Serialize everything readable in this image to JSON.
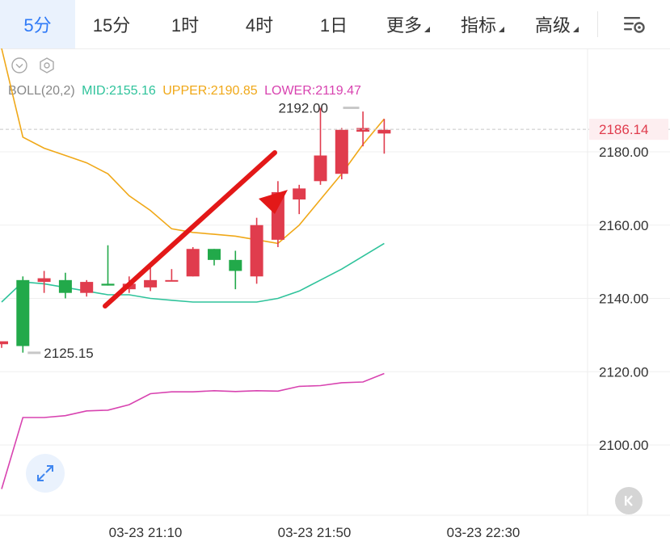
{
  "tabs": [
    {
      "label": "5分",
      "active": true,
      "dropdown": false
    },
    {
      "label": "15分",
      "active": false,
      "dropdown": false
    },
    {
      "label": "1时",
      "active": false,
      "dropdown": false
    },
    {
      "label": "4时",
      "active": false,
      "dropdown": false
    },
    {
      "label": "1日",
      "active": false,
      "dropdown": false
    },
    {
      "label": "更多",
      "active": false,
      "dropdown": true
    },
    {
      "label": "指标",
      "active": false,
      "dropdown": true
    },
    {
      "label": "高级",
      "active": false,
      "dropdown": true
    }
  ],
  "icons": {
    "settings": "chart-settings-icon",
    "collapse": "chevron-down-circle-icon",
    "indicator_settings": "hexagon-settings-icon",
    "expand": "expand-arrows-icon",
    "scroll_latest": "skip-to-latest-icon"
  },
  "legend": {
    "name": "BOLL(20,2)",
    "mid": "MID:2155.16",
    "upper": "UPPER:2190.85",
    "lower": "LOWER:2119.47"
  },
  "colors": {
    "accent": "#2f7af7",
    "up": "#e03c4d",
    "down": "#22a94a",
    "mid": "#2fc39b",
    "upper": "#f0a818",
    "lower": "#d843b0",
    "arrow": "#e31818",
    "grid": "#efefef",
    "current_price_bg": "#fdeef0"
  },
  "chart_data": {
    "type": "candlestick",
    "indicator": "BOLL(20,2)",
    "current_price": 2186.14,
    "high_label": "2192.00",
    "low_label": "2125.15",
    "ylim": [
      2088,
      2207
    ],
    "yticks": [
      "2180.00",
      "2160.00",
      "2140.00",
      "2120.00",
      "2100.00"
    ],
    "xticks": [
      "03-23 21:10",
      "03-23 21:50",
      "03-23 22:30"
    ],
    "candles": [
      {
        "open": 2127.5,
        "high": 2127.8,
        "low": 2126.5,
        "close": 2128.3
      },
      {
        "open": 2145.0,
        "high": 2146.0,
        "low": 2125.2,
        "close": 2127.0
      },
      {
        "open": 2144.5,
        "high": 2147.5,
        "low": 2141.5,
        "close": 2145.5
      },
      {
        "open": 2145.0,
        "high": 2147.0,
        "low": 2140.0,
        "close": 2141.5
      },
      {
        "open": 2141.5,
        "high": 2145.0,
        "low": 2140.5,
        "close": 2144.5
      },
      {
        "open": 2144.0,
        "high": 2154.5,
        "low": 2143.5,
        "close": 2143.5
      },
      {
        "open": 2142.5,
        "high": 2146.0,
        "low": 2141.5,
        "close": 2144.0
      },
      {
        "open": 2143.0,
        "high": 2149.5,
        "low": 2142.0,
        "close": 2145.0
      },
      {
        "open": 2145.0,
        "high": 2148.0,
        "low": 2145.0,
        "close": 2145.0
      },
      {
        "open": 2146.0,
        "high": 2154.0,
        "low": 2146.0,
        "close": 2153.5
      },
      {
        "open": 2153.5,
        "high": 2153.5,
        "low": 2149.0,
        "close": 2150.5
      },
      {
        "open": 2150.5,
        "high": 2153.0,
        "low": 2142.5,
        "close": 2147.5
      },
      {
        "open": 2146.0,
        "high": 2162.0,
        "low": 2144.0,
        "close": 2160.0
      },
      {
        "open": 2156.0,
        "high": 2172.0,
        "low": 2154.0,
        "close": 2169.0
      },
      {
        "open": 2167.0,
        "high": 2171.0,
        "low": 2163.0,
        "close": 2170.0
      },
      {
        "open": 2172.0,
        "high": 2192.0,
        "low": 2171.0,
        "close": 2179.0
      },
      {
        "open": 2174.0,
        "high": 2186.5,
        "low": 2172.5,
        "close": 2186.0
      },
      {
        "open": 2185.5,
        "high": 2191.0,
        "low": 2181.5,
        "close": 2186.5
      },
      {
        "open": 2185.0,
        "high": 2189.0,
        "low": 2179.5,
        "close": 2186.0
      }
    ],
    "upper_band": [
      2210,
      2184,
      2181,
      2179,
      2177,
      2174,
      2168,
      2164,
      2159,
      2158,
      2157.5,
      2157,
      2156,
      2155,
      2160,
      2167,
      2174,
      2182,
      2189
    ],
    "mid_band": [
      2139,
      2144.5,
      2144,
      2143,
      2142,
      2141,
      2141,
      2140,
      2139.5,
      2139,
      2139,
      2139,
      2139,
      2140,
      2142,
      2145,
      2148,
      2151.5,
      2155
    ],
    "lower_band": [
      2088,
      2107.5,
      2107.5,
      2108,
      2109.3,
      2109.5,
      2111,
      2114,
      2114.5,
      2114.5,
      2114.8,
      2114.6,
      2114.8,
      2114.7,
      2116,
      2116.2,
      2117,
      2117.2,
      2119.5
    ]
  }
}
